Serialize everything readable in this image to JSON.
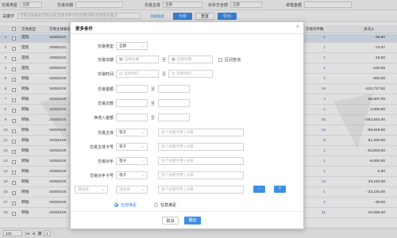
{
  "filters": {
    "trade_type_label": "交易类型",
    "trade_type_value": "全部",
    "trade_date_label": "交易日期",
    "subject_label": "交易主体",
    "subject_value": "全部",
    "counter_label": "对手方全部",
    "counter_value": "全部",
    "unit_label": "单笔金额"
  },
  "search": {
    "keyword_label": "关键字",
    "keyword_placeholder": "交易主体账号/交易主体/交易对手卡号/交易对手/交易地点/备注",
    "advanced_link": "高级搜索",
    "analyze_btn": "分析",
    "reset_btn": "重置",
    "export_btn": "导出"
  },
  "table": {
    "headers": {
      "type": "交易类型",
      "subject": "交易主体",
      "account": "交易主体账号",
      "count": "交易对手数",
      "inflow": "净流入"
    },
    "rows": [
      {
        "idx": "1",
        "type": "提现",
        "account": "20880220",
        "count": "1",
        "inflow": "-39.90"
      },
      {
        "idx": "2",
        "type": "提现",
        "account": "20880220",
        "count": "1",
        "inflow": "-73.07"
      },
      {
        "idx": "3",
        "type": "提现",
        "account": "20880220",
        "count": "1",
        "inflow": "-15.00"
      },
      {
        "idx": "4",
        "type": "提现",
        "account": "20880220",
        "count": "1",
        "inflow": "-102.58"
      },
      {
        "idx": "5",
        "type": "转账",
        "account": "34050100",
        "count": "1",
        "inflow": "-200.00"
      },
      {
        "idx": "6",
        "type": "转账",
        "account": "34050100",
        "count": "19",
        "inflow": "-210,717.00"
      },
      {
        "idx": "7",
        "type": "转账",
        "account": "34050100",
        "count": "4",
        "inflow": "56,807.00"
      },
      {
        "idx": "8",
        "type": "转账",
        "account": "34050100",
        "count": "1",
        "inflow": "2,000.00"
      },
      {
        "idx": "9",
        "type": "转账",
        "account": "34050100",
        "count": "25",
        "inflow": "-292,842.00"
      },
      {
        "idx": "10",
        "type": "转账",
        "account": "34050100",
        "count": "12",
        "inflow": "-98,818.00"
      },
      {
        "idx": "11",
        "type": "转账",
        "account": "34050100",
        "count": "5",
        "inflow": "81,200.00"
      },
      {
        "idx": "12",
        "type": "转账",
        "account": "34050100",
        "count": "1",
        "inflow": "-54,004.00"
      },
      {
        "idx": "13",
        "type": "转账",
        "account": "34050100",
        "count": "1",
        "inflow": "-6,000.00"
      },
      {
        "idx": "14",
        "type": "转账",
        "account": "34050100",
        "count": "1",
        "inflow": "0.00"
      },
      {
        "idx": "15",
        "type": "转账",
        "account": "34050100",
        "count": "13",
        "inflow": "33,184.00"
      },
      {
        "idx": "16",
        "type": "转账",
        "account": "34050100",
        "count": "1",
        "inflow": "-33,184.00"
      },
      {
        "idx": "17",
        "type": "转账",
        "account": "34050100",
        "count": "1",
        "inflow": "-30.00"
      },
      {
        "idx": "18",
        "type": "转账",
        "account": "34050100",
        "count": "11",
        "inflow": "10,936.00"
      }
    ]
  },
  "pager": {
    "page_size": "100",
    "page_label": "第",
    "page_value": "1"
  },
  "watermark": "MRD",
  "modal": {
    "title": "更多条件",
    "close": "×",
    "fields": {
      "trade_type": {
        "label": "交易类型",
        "value": "全部"
      },
      "trade_date": {
        "label": "交易日期",
        "start": "选择日期",
        "end": "选择日期",
        "sep": "至",
        "interval_label": "区间查询"
      },
      "trade_time": {
        "label": "交易时间",
        "start": "选择时间",
        "end": "选择时间",
        "sep": "至"
      },
      "amount": {
        "label": "交易金额",
        "sep": "至"
      },
      "times": {
        "label": "交易次数",
        "sep": "至"
      },
      "net_amount": {
        "label": "净流入金额",
        "sep": "至"
      },
      "subject": {
        "label": "交易主体",
        "op": "等于",
        "placeholder": "多个关键字用 | 分隔"
      },
      "subject_card": {
        "label": "交易主体卡号",
        "op": "等于",
        "placeholder": "多个关键字用 | 分隔"
      },
      "counter": {
        "label": "交易对手",
        "op": "等于",
        "placeholder": "多个关键字用 | 分隔"
      },
      "counter_card": {
        "label": "交易对手卡号",
        "op": "等于",
        "placeholder": "多个关键字用 | 分隔"
      },
      "custom": {
        "field": "请选择",
        "op": "请选择",
        "placeholder": "多个关键字用 | 分隔",
        "minus": "-",
        "plus": "+"
      }
    },
    "match": {
      "all": "全部满足",
      "any": "任意满足"
    },
    "cancel_btn": "取消",
    "ok_btn": "确定"
  },
  "colors": {
    "accent": "#3f8ee6"
  }
}
